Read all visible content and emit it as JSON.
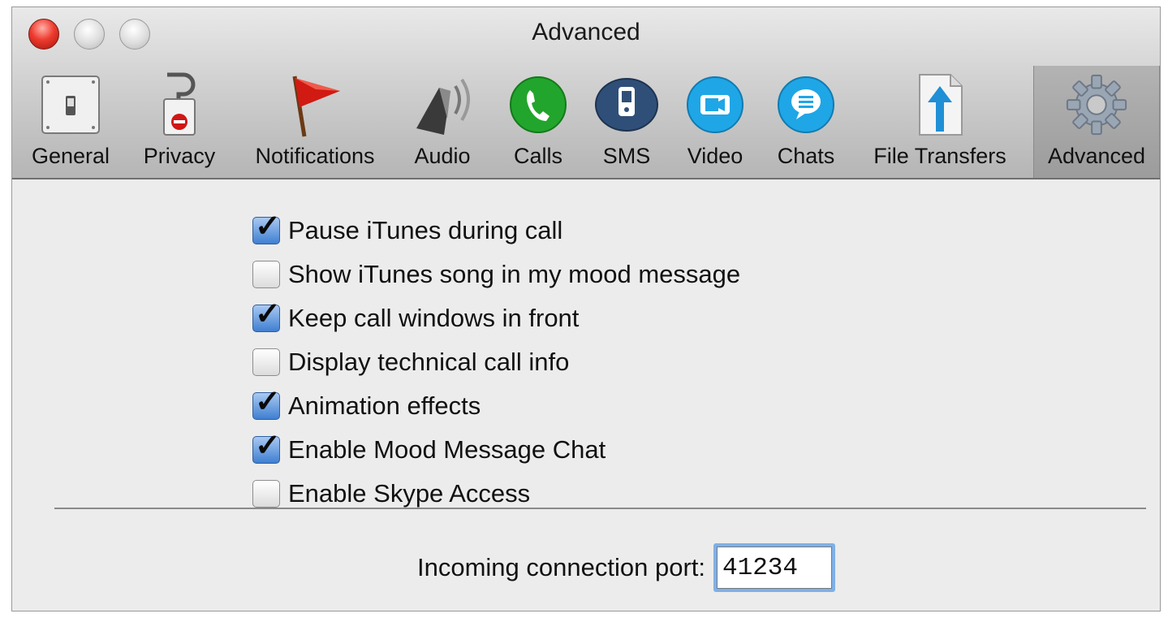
{
  "window": {
    "title": "Advanced"
  },
  "toolbar": {
    "items": [
      {
        "label": "General",
        "icon": "switch-icon"
      },
      {
        "label": "Privacy",
        "icon": "lock-sign-icon"
      },
      {
        "label": "Notifications",
        "icon": "red-flag-icon"
      },
      {
        "label": "Audio",
        "icon": "speaker-icon"
      },
      {
        "label": "Calls",
        "icon": "phone-icon"
      },
      {
        "label": "SMS",
        "icon": "mobile-phone-icon"
      },
      {
        "label": "Video",
        "icon": "video-camera-icon"
      },
      {
        "label": "Chats",
        "icon": "chat-bubble-icon"
      },
      {
        "label": "File Transfers",
        "icon": "file-upload-icon"
      },
      {
        "label": "Advanced",
        "icon": "gear-icon"
      }
    ],
    "selected": "Advanced"
  },
  "options": [
    {
      "label": "Pause iTunes during call",
      "checked": true
    },
    {
      "label": "Show iTunes song in my mood message",
      "checked": false
    },
    {
      "label": "Keep call windows in front",
      "checked": true
    },
    {
      "label": "Display technical call info",
      "checked": false
    },
    {
      "label": "Animation effects",
      "checked": true
    },
    {
      "label": "Enable Mood Message Chat",
      "checked": true
    },
    {
      "label": "Enable Skype Access",
      "checked": false
    }
  ],
  "port": {
    "label": "Incoming connection port:",
    "value": "41234"
  },
  "colors": {
    "accent": "#3f7fd2",
    "calls_green": "#22a52c",
    "sms_navy": "#2f4f78",
    "chat_blue": "#1fa6e6"
  }
}
